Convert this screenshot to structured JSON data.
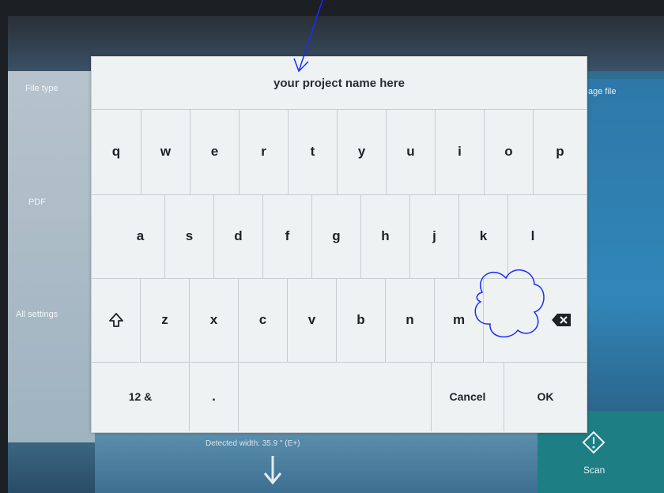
{
  "background": {
    "left_panel": {
      "file_type_label": "File type",
      "format_value": "PDF",
      "all_settings_label": "All settings"
    },
    "right_panel": {
      "label": "age file"
    },
    "status": {
      "detected_width": "Detected width: 35.9 \" (E+)"
    },
    "scan_button_label": "Scan"
  },
  "keyboard": {
    "title": "your project name here",
    "row1": [
      "q",
      "w",
      "e",
      "r",
      "t",
      "y",
      "u",
      "i",
      "o",
      "p"
    ],
    "row2": [
      "a",
      "s",
      "d",
      "f",
      "g",
      "h",
      "j",
      "k",
      "l"
    ],
    "row3": [
      "z",
      "x",
      "c",
      "v",
      "b",
      "n",
      "m"
    ],
    "row4": {
      "numbers_label": "12 &",
      "period_label": ".",
      "cancel_label": "Cancel",
      "ok_label": "OK"
    }
  },
  "colors": {
    "annotation": "#1a2bff",
    "keyboard_bg": "#eef2f3",
    "scan_tile": "#1d7e84"
  }
}
